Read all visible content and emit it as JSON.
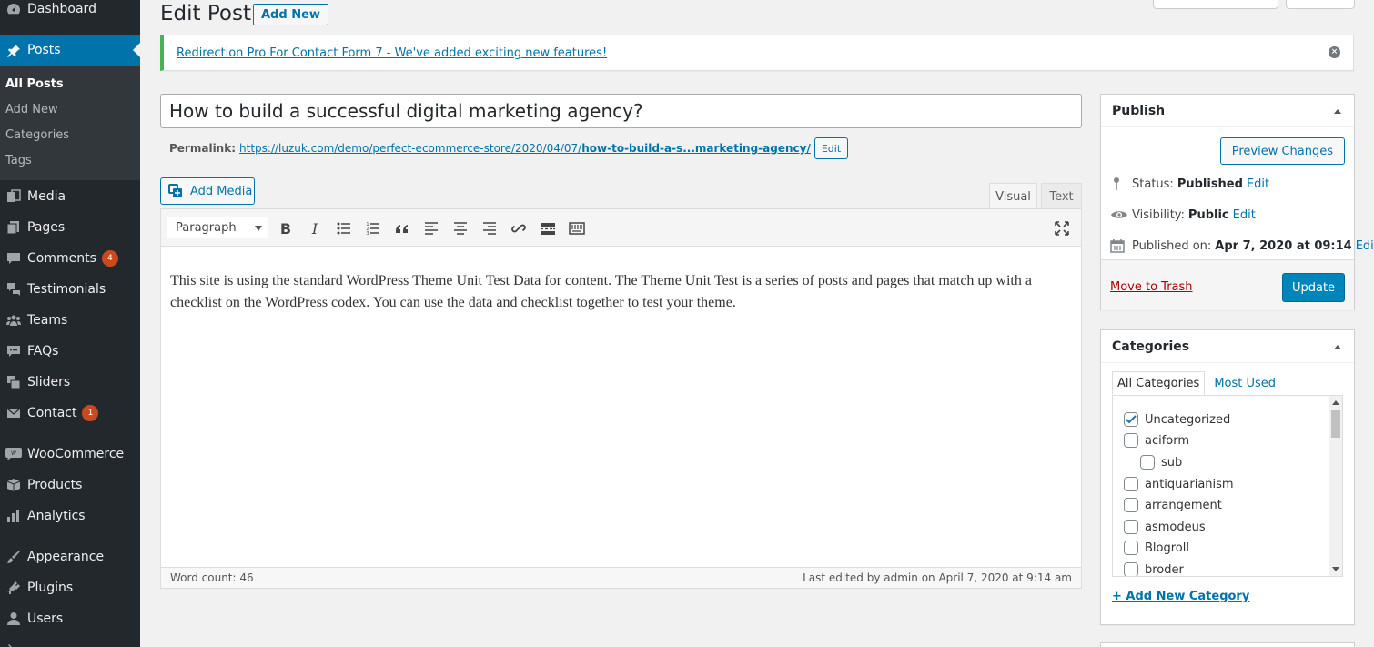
{
  "sidebar": {
    "items": [
      {
        "label": "Dashboard",
        "icon": "dashboard-icon"
      },
      {
        "label": "Posts",
        "icon": "pin-icon"
      },
      {
        "label": "Media",
        "icon": "media-icon"
      },
      {
        "label": "Pages",
        "icon": "pages-icon"
      },
      {
        "label": "Comments",
        "icon": "comment-icon",
        "badge": "4"
      },
      {
        "label": "Testimonials",
        "icon": "testimonial-icon"
      },
      {
        "label": "Teams",
        "icon": "groups-icon"
      },
      {
        "label": "FAQs",
        "icon": "faq-icon"
      },
      {
        "label": "Sliders",
        "icon": "sliders-icon"
      },
      {
        "label": "Contact",
        "icon": "mail-icon",
        "badge": "1"
      },
      {
        "label": "WooCommerce",
        "icon": "woocommerce-icon"
      },
      {
        "label": "Products",
        "icon": "archive-icon"
      },
      {
        "label": "Analytics",
        "icon": "chart-bar-icon"
      },
      {
        "label": "Appearance",
        "icon": "brush-icon"
      },
      {
        "label": "Plugins",
        "icon": "plugin-icon"
      },
      {
        "label": "Users",
        "icon": "user-icon"
      }
    ],
    "submenu": [
      "All Posts",
      "Add New",
      "Categories",
      "Tags"
    ]
  },
  "header": {
    "title": "Edit Post",
    "add_new_label": "Add New"
  },
  "notice": {
    "link_text": "Redirection Pro For Contact Form 7 - We've added exciting new features!"
  },
  "post": {
    "title": "How to build a successful digital marketing agency?",
    "permalink_label": "Permalink:",
    "permalink_base": "https://luzuk.com/demo/perfect-ecommerce-store/2020/04/07/",
    "permalink_slug": "how-to-build-a-s...marketing-agency/",
    "permalink_edit_label": "Edit"
  },
  "editor": {
    "add_media_label": "Add Media",
    "tab_visual": "Visual",
    "tab_text": "Text",
    "format_select": "Paragraph",
    "content": "This site is using the standard WordPress Theme Unit Test Data for content. The Theme Unit Test is a series of posts and pages that match up with a checklist on the WordPress codex. You can use the data and checklist together to test your theme.",
    "word_count": "Word count: 46",
    "last_edited": "Last edited by admin on April 7, 2020 at 9:14 am"
  },
  "publish": {
    "title": "Publish",
    "preview_label": "Preview Changes",
    "status_label": "Status:",
    "status_value": "Published",
    "visibility_label": "Visibility:",
    "visibility_value": "Public",
    "published_label": "Published on:",
    "published_value": "Apr 7, 2020 at 09:14",
    "edit_label": "Edit",
    "trash_label": "Move to Trash",
    "update_label": "Update"
  },
  "categories": {
    "title": "Categories",
    "tab_all": "All Categories",
    "tab_most_used": "Most Used",
    "items": [
      {
        "label": "Uncategorized",
        "checked": true
      },
      {
        "label": "aciform",
        "checked": false
      },
      {
        "label": "sub",
        "checked": false
      },
      {
        "label": "antiquarianism",
        "checked": false
      },
      {
        "label": "arrangement",
        "checked": false
      },
      {
        "label": "asmodeus",
        "checked": false
      },
      {
        "label": "Blogroll",
        "checked": false
      },
      {
        "label": "broder",
        "checked": false
      }
    ],
    "add_new_label": "+ Add New Category"
  },
  "colors": {
    "sidebar_bg": "#23282d",
    "accent": "#0073aa",
    "update_button": "#0085ba",
    "notice_border": "#46b450",
    "badge": "#ca4a1f",
    "trash": "#a00"
  }
}
